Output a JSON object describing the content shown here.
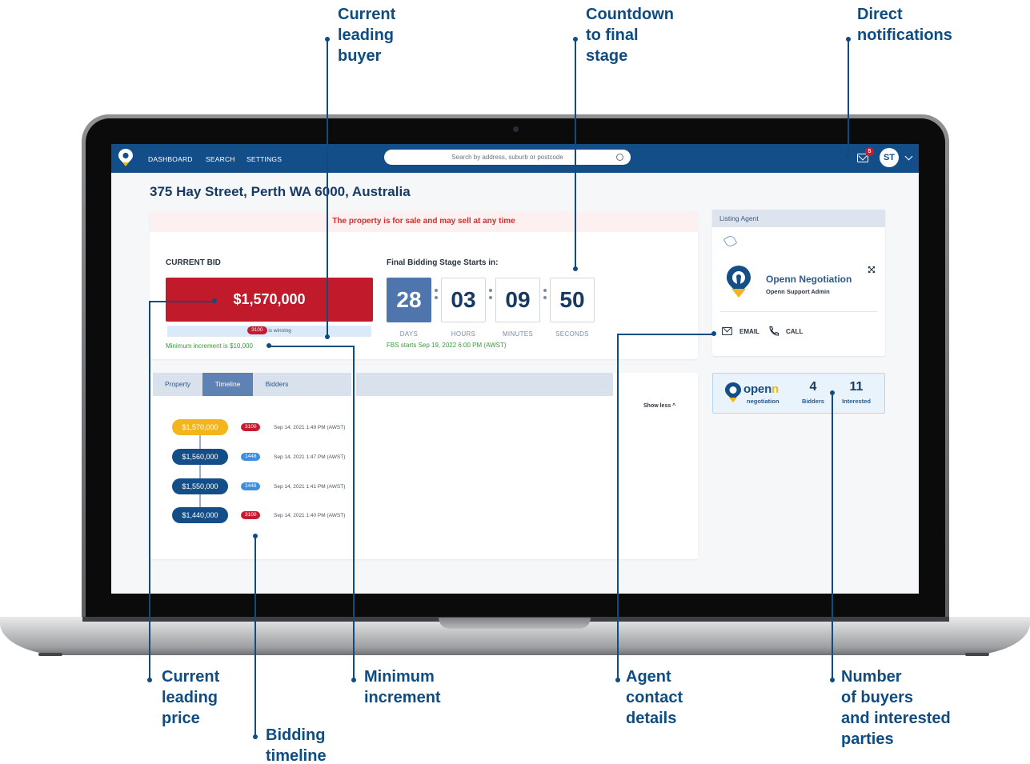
{
  "callouts": {
    "leading_buyer": [
      "Current",
      "leading",
      "buyer"
    ],
    "countdown": [
      "Countdown",
      "to final",
      "stage"
    ],
    "notifications": [
      "Direct",
      "notifications"
    ],
    "leading_price": [
      "Current",
      "leading",
      "price"
    ],
    "bidding_timeline": [
      "Bidding",
      "timeline"
    ],
    "min_increment": [
      "Minimum",
      "increment"
    ],
    "agent_contact": [
      "Agent",
      "contact",
      "details"
    ],
    "buyers_interested": [
      "Number",
      "of buyers",
      "and interested",
      "parties"
    ]
  },
  "nav": {
    "links": [
      "DASHBOARD",
      "SEARCH",
      "SETTINGS"
    ],
    "search_placeholder": "Search by address, suburb or postcode",
    "notification_count": "5",
    "avatar_initials": "ST"
  },
  "property": {
    "address": "375 Hay Street, Perth WA 6000, Australia",
    "alert": "The property is for sale and may sell at any time"
  },
  "bid": {
    "label": "CURRENT BID",
    "amount": "$1,570,000",
    "leader_id": "3100",
    "winning_text": "is winning",
    "min_increment": "Minimum increment is $10,000"
  },
  "countdown": {
    "label": "Final Bidding Stage Starts in:",
    "days": "28",
    "hours": "03",
    "minutes": "09",
    "seconds": "50",
    "days_label": "DAYS",
    "hours_label": "HOURS",
    "minutes_label": "MINUTES",
    "seconds_label": "SECONDS",
    "fbs_starts": "FBS starts Sep 19, 2022 6:00 PM (AWST)"
  },
  "tabs": [
    "Property",
    "Timeline",
    "Bidders"
  ],
  "timeline": {
    "show_less": "Show less ^",
    "entries": [
      {
        "amount": "$1,570,000",
        "bidder": "3100",
        "time": "Sep 14, 2021 1:49 PM (AWST)"
      },
      {
        "amount": "$1,560,000",
        "bidder": "1448",
        "time": "Sep 14, 2021 1:47 PM (AWST)"
      },
      {
        "amount": "$1,550,000",
        "bidder": "1448",
        "time": "Sep 14, 2021 1:41 PM (AWST)"
      },
      {
        "amount": "$1,440,000",
        "bidder": "3100",
        "time": "Sep 14, 2021 1:40 PM (AWST)"
      }
    ]
  },
  "agent": {
    "header": "Listing Agent",
    "name": "Openn Negotiation",
    "role": "Openn Support Admin",
    "email_label": "EMAIL",
    "call_label": "CALL"
  },
  "stats": {
    "brand_a": "open",
    "brand_b": "n",
    "brand_sub": "negotiation",
    "bidders_count": "4",
    "bidders_label": "Bidders",
    "interested_count": "11",
    "interested_label": "Interested"
  },
  "colors": {
    "brand_navy": "#144e88",
    "bid_red": "#c11a2b",
    "accent_gold": "#f3b51b",
    "callout_blue": "#0f4c81"
  }
}
